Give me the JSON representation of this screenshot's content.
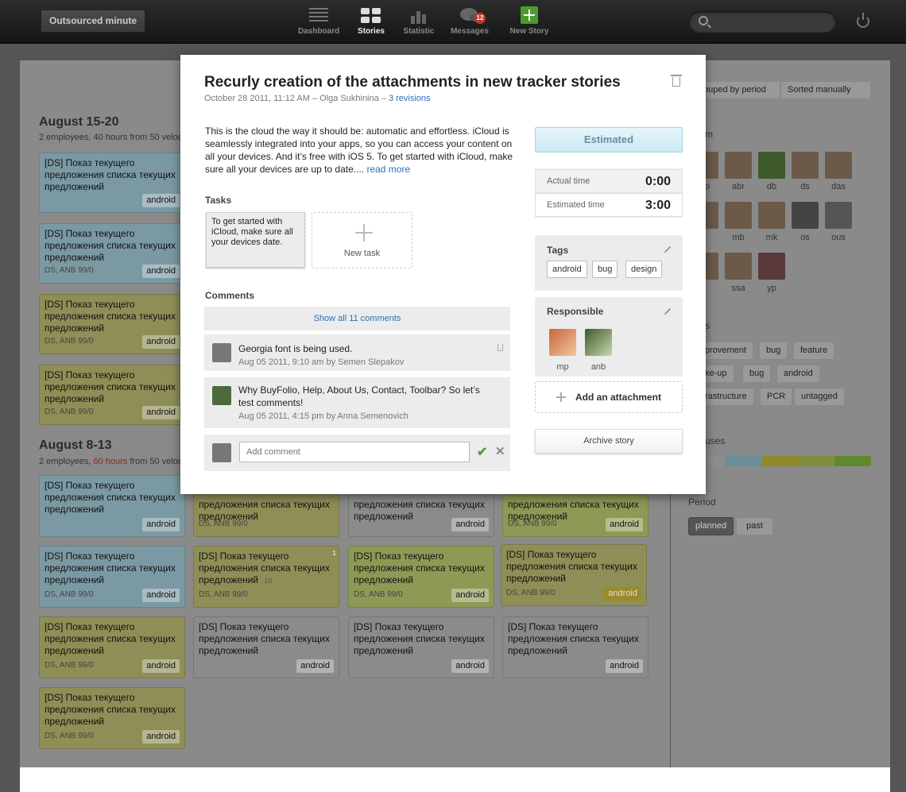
{
  "topbar": {
    "brand": "Outsourced minute",
    "nav": [
      {
        "label": "Dashboard"
      },
      {
        "label": "Stories"
      },
      {
        "label": "Statistic"
      },
      {
        "label": "Messages",
        "badge": "12"
      },
      {
        "label": "New Story"
      }
    ]
  },
  "background": {
    "groups": [
      {
        "title": "August 15-20",
        "subtitle": "2 employees, 40 hours from 50 veloc"
      },
      {
        "title": "August 8-13",
        "subtitle_a": "2 employees, ",
        "subtitle_hours": "60 hours",
        "subtitle_b": " from 50 veloc"
      }
    ],
    "card_title": "[DS] Показ текущего предложения списка текущих предложений",
    "card_title_partial": "предложения списка текущих предложений",
    "card_meta": "DS, ANB 99/0",
    "card_tag": "android",
    "card_corner_badge": "1",
    "card_comment_count": "10",
    "sidebar": {
      "sort_grouped": "ouped by period",
      "sort_manual": "Sorted manually",
      "team_heading": "m",
      "team_labels": [
        "o",
        "abr",
        "db",
        "ds",
        "das",
        "",
        "mb",
        "mk",
        "os",
        "ous",
        "",
        "ssa",
        "yp"
      ],
      "tags_heading": "s",
      "tags": [
        "provement",
        "bug",
        "feature",
        "ke-up",
        "bug",
        "android",
        "rastructure",
        "PCR",
        "untagged"
      ],
      "statuses_heading": "uses",
      "period_heading": "Period",
      "period_planned": "planned",
      "period_past": "past"
    }
  },
  "modal": {
    "title": "Recurly creation of the attachments in new tracker stories",
    "meta": "October 28 2011, 11:12 AM – Olga Sukhinina – ",
    "revisions": "3 revisions",
    "description": "This is the cloud the way it should be: automatic and effortless. iCloud is seamlessly integrated into your apps, so you can access your content on all your devices. And it’s free with iOS 5. To get started with iCloud, make sure all your devices are up to date.... ",
    "read_more": "read more",
    "tasks_heading": "Tasks",
    "task_text": "To get started with iCloud, make sure all your devices date.",
    "new_task": "New task",
    "comments_heading": "Comments",
    "show_all": "Show all 11 comments",
    "comments": [
      {
        "text": "Georgia font is being used.",
        "meta": "Aug 05 2011, 9:10 am by Semen Slepakov"
      },
      {
        "text": "Why BuyFolio, Help, About Us, Contact, Toolbar? So let’s test comments!",
        "meta": "Aug 05 2011, 4:15 pm by Anna Semenovich"
      }
    ],
    "add_comment_placeholder": "Add comment",
    "status_button": "Estimated",
    "actual_time_label": "Actual time",
    "actual_time_value": "0:00",
    "estimated_time_label": "Estimated time",
    "estimated_time_value": "3:00",
    "tags_heading": "Tags",
    "tags": [
      "android",
      "bug",
      "design"
    ],
    "responsible_heading": "Responsible",
    "responsible": [
      "mp",
      "anb"
    ],
    "add_attachment": "Add an attachment",
    "archive": "Archive story"
  },
  "colors": {
    "accent_link": "#2a6fb8",
    "hours_warning": "#c0392b",
    "card_blue": "#c3e5f0",
    "card_yellow": "#ecec92",
    "card_green": "#d7ee8e",
    "card_grey": "#e0e0e0"
  }
}
